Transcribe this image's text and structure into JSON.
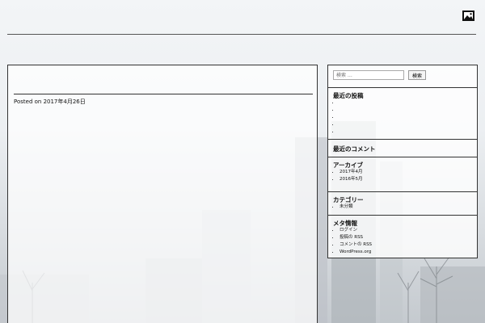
{
  "site": {
    "title": "",
    "header_icon": "image-icon"
  },
  "post": {
    "title": "",
    "meta": "Posted on 2017年4月26日",
    "subtitle": "",
    "paragraphs": [
      "",
      "",
      "",
      "",
      "",
      "",
      "",
      "",
      "",
      "",
      "",
      "",
      "",
      "",
      "",
      "",
      ""
    ]
  },
  "sidebar": {
    "search": {
      "placeholder": "検索 …",
      "button_label": "検索"
    },
    "recent_posts": {
      "title": "最近の投稿",
      "items": [
        "",
        "",
        "",
        "",
        ""
      ]
    },
    "recent_comments": {
      "title": "最近のコメント"
    },
    "archives": {
      "title": "アーカイブ",
      "items": [
        "2017年4月",
        "2016年5月"
      ]
    },
    "categories": {
      "title": "カテゴリー",
      "items": [
        "未分類"
      ]
    },
    "meta": {
      "title": "メタ情報",
      "items": [
        "ログイン",
        "投稿の RSS",
        "コメントの RSS",
        "WordPress.org"
      ]
    }
  }
}
